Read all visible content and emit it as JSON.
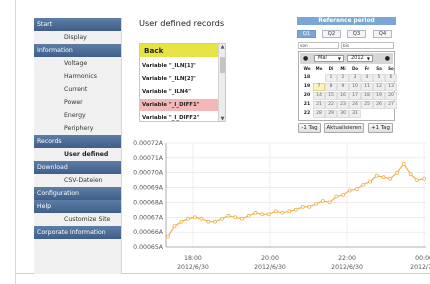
{
  "sidebar": {
    "groups": [
      {
        "header": "Start",
        "items": [
          {
            "label": "Display"
          }
        ]
      },
      {
        "header": "Information",
        "items": [
          {
            "label": "Voltage"
          },
          {
            "label": "Harmonics"
          },
          {
            "label": "Current"
          },
          {
            "label": "Power"
          },
          {
            "label": "Energy"
          },
          {
            "label": "Periphery"
          }
        ]
      },
      {
        "header": "Records",
        "items": [
          {
            "label": "User defined",
            "active": true
          }
        ]
      },
      {
        "header": "Download",
        "items": [
          {
            "label": "CSV-Dateien"
          }
        ]
      },
      {
        "header": "Configuration",
        "items": []
      },
      {
        "header": "Help",
        "items": [
          {
            "label": "Customize Site"
          }
        ]
      },
      {
        "header": "Corporate Information",
        "items": []
      }
    ]
  },
  "main": {
    "title": "User defined records"
  },
  "records": {
    "back_label": "Back",
    "variables": [
      {
        "label": "Variable \"_ILN[1]\"",
        "selected": false
      },
      {
        "label": "Variable \"_ILN[2]\"",
        "selected": false
      },
      {
        "label": "Variable \"_ILN4\"",
        "selected": false
      },
      {
        "label": "Variable \"_I_DIFF1\"",
        "selected": true
      },
      {
        "label": "Variable \"_I_DIFF2\"",
        "selected": false
      }
    ]
  },
  "reference_period": {
    "title": "Reference period",
    "quarters": [
      {
        "label": "Q1",
        "active": true
      },
      {
        "label": "Q2",
        "active": false
      },
      {
        "label": "Q3",
        "active": false
      },
      {
        "label": "Q4",
        "active": false
      }
    ],
    "from_label": "von",
    "to_label": "bis",
    "calendar": {
      "month": "Mai",
      "year": "2012",
      "prev_icon": "prev-month-icon",
      "next_icon": "next-month-icon",
      "weekday_headers": [
        "Wo",
        "Mo",
        "Di",
        "Mi",
        "Do",
        "Fr",
        "Sa",
        "So"
      ],
      "weeks": [
        {
          "week": "18",
          "days": [
            "",
            "1",
            "2",
            "3",
            "4",
            "5",
            "6"
          ]
        },
        {
          "week": "19",
          "days": [
            "7",
            "8",
            "9",
            "10",
            "11",
            "12",
            "13"
          ]
        },
        {
          "week": "20",
          "days": [
            "14",
            "15",
            "16",
            "17",
            "18",
            "19",
            "20"
          ]
        },
        {
          "week": "21",
          "days": [
            "21",
            "22",
            "23",
            "24",
            "25",
            "26",
            "27"
          ]
        },
        {
          "week": "22",
          "days": [
            "28",
            "29",
            "30",
            "31",
            "",
            "",
            ""
          ]
        }
      ],
      "today": "7"
    },
    "buttons": {
      "minus_day": "-1 Tag",
      "refresh": "Aktualisieren",
      "plus_day": "+1 Tag"
    }
  },
  "chart_data": {
    "type": "line",
    "title": "",
    "xlabel": "",
    "ylabel": "",
    "x_ticks": [
      {
        "time": "18:00",
        "date": "2012/6/30",
        "x_hours": 18
      },
      {
        "time": "20:00",
        "date": "2012/6/30",
        "x_hours": 20
      },
      {
        "time": "22:00",
        "date": "2012/6/30",
        "x_hours": 22
      },
      {
        "time": "00:00",
        "date": "2012/7/1",
        "x_hours": 24
      }
    ],
    "xlim": [
      17.3,
      24.05
    ],
    "y_ticks": [
      "0.00072A",
      "0.00071A",
      "0.00070A",
      "0.00069A",
      "0.00068A",
      "0.00067A",
      "0.00066A",
      "0.00065A"
    ],
    "y_tick_values": [
      0.00072,
      0.00071,
      0.0007,
      0.00069,
      0.00068,
      0.00067,
      0.00066,
      0.00065
    ],
    "ylim": [
      0.00065,
      0.00072
    ],
    "grid": true,
    "line_color": "#f0b24a",
    "series": [
      {
        "points": [
          [
            17.35,
            0.000657
          ],
          [
            17.52,
            0.000664
          ],
          [
            17.7,
            0.000667
          ],
          [
            17.87,
            0.000669
          ],
          [
            18.05,
            0.00067
          ],
          [
            18.22,
            0.000669
          ],
          [
            18.4,
            0.000667
          ],
          [
            18.57,
            0.000667
          ],
          [
            18.75,
            0.000669
          ],
          [
            18.92,
            0.000671
          ],
          [
            19.1,
            0.00067
          ],
          [
            19.27,
            0.000669
          ],
          [
            19.45,
            0.000671
          ],
          [
            19.62,
            0.000673
          ],
          [
            19.8,
            0.000672
          ],
          [
            19.97,
            0.000672
          ],
          [
            20.15,
            0.000674
          ],
          [
            20.32,
            0.000673
          ],
          [
            20.5,
            0.000674
          ],
          [
            20.67,
            0.000675
          ],
          [
            20.85,
            0.000677
          ],
          [
            21.02,
            0.000677
          ],
          [
            21.2,
            0.000679
          ],
          [
            21.37,
            0.000681
          ],
          [
            21.55,
            0.00068
          ],
          [
            21.72,
            0.000684
          ],
          [
            21.9,
            0.000685
          ],
          [
            22.07,
            0.000688
          ],
          [
            22.25,
            0.000689
          ],
          [
            22.42,
            0.000692
          ],
          [
            22.6,
            0.000694
          ],
          [
            22.77,
            0.000698
          ],
          [
            22.95,
            0.000697
          ],
          [
            23.12,
            0.000696
          ],
          [
            23.3,
            0.0007
          ],
          [
            23.47,
            0.000706
          ],
          [
            23.65,
            0.000699
          ],
          [
            23.82,
            0.000695
          ],
          [
            24.0,
            0.000696
          ]
        ]
      }
    ]
  }
}
